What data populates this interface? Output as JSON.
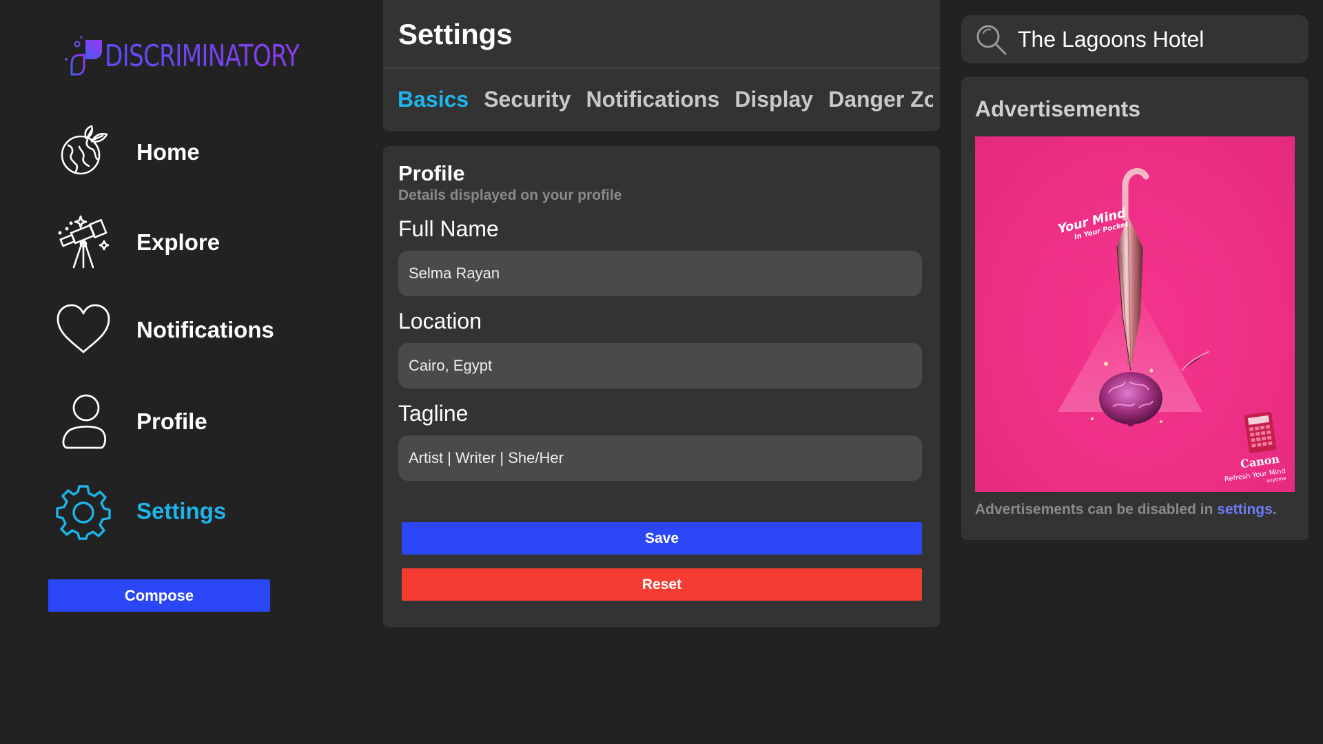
{
  "brand": {
    "name": "DISCRIMINATORY",
    "accent": "#6d4cf7"
  },
  "sidebar": {
    "items": [
      {
        "label": "Home",
        "icon": "globe-leaves-icon"
      },
      {
        "label": "Explore",
        "icon": "telescope-icon"
      },
      {
        "label": "Notifications",
        "icon": "heart-icon"
      },
      {
        "label": "Profile",
        "icon": "user-icon"
      },
      {
        "label": "Settings",
        "icon": "gear-icon",
        "active": true
      }
    ],
    "compose_label": "Compose"
  },
  "settings": {
    "title": "Settings",
    "tabs": [
      {
        "label": "Basics",
        "active": true
      },
      {
        "label": "Security"
      },
      {
        "label": "Notifications"
      },
      {
        "label": "Display"
      },
      {
        "label": "Danger Zone"
      }
    ]
  },
  "profile": {
    "title": "Profile",
    "subtitle": "Details displayed on your profile",
    "fields": [
      {
        "label": "Full Name",
        "value": "Selma Rayan"
      },
      {
        "label": "Location",
        "value": "Cairo, Egypt"
      },
      {
        "label": "Tagline",
        "value": "Artist | Writer | She/Her"
      }
    ],
    "save_label": "Save",
    "reset_label": "Reset"
  },
  "search": {
    "value": "The Lagoons Hotel"
  },
  "ads": {
    "title": "Advertisements",
    "image": {
      "headline_1": "Your Mind",
      "headline_2": "In Your Pocket",
      "brand": "Canon",
      "slogan_1": "Refresh Your Mind",
      "slogan_2": "anytime"
    },
    "note_prefix": "Advertisements can be disabled in ",
    "note_link": "settings",
    "note_suffix": "."
  },
  "colors": {
    "background": "#222222",
    "panel": "#333333",
    "input": "#4a4a4a",
    "active_blue": "#1db5ea",
    "primary_button": "#2b47f5",
    "danger_button": "#f43c33",
    "ad_pink": "#ee2f86"
  }
}
